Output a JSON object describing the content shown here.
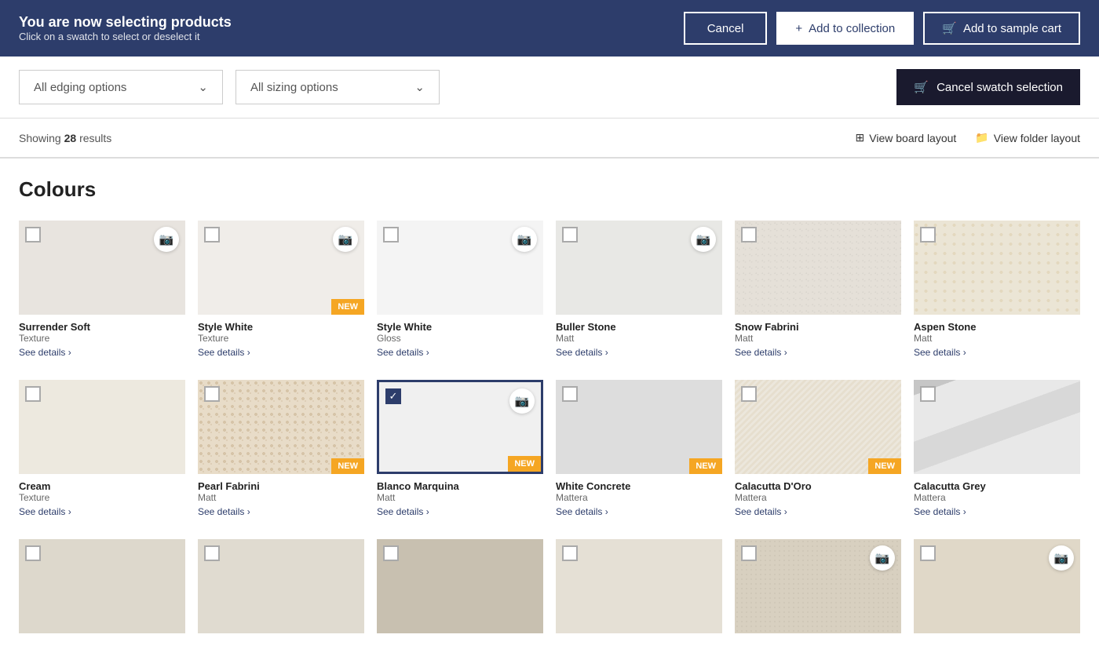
{
  "topBar": {
    "heading": "You are now selecting products",
    "subtext": "Click on a swatch to select or deselect it",
    "cancelLabel": "Cancel",
    "addToCollectionLabel": "Add to collection",
    "addToSampleCartLabel": "Add to sample cart"
  },
  "filters": {
    "edgingPlaceholder": "All edging options",
    "sizingPlaceholder": "All sizing options",
    "cancelSwatchLabel": "Cancel swatch selection"
  },
  "results": {
    "showing": "Showing",
    "count": "28",
    "resultsLabel": "results",
    "viewBoardLabel": "View board layout",
    "viewFolderLabel": "View folder layout"
  },
  "section": {
    "title": "Colours"
  },
  "row1": [
    {
      "name": "Surrender Soft",
      "type": "Texture",
      "link": "See details",
      "new": false,
      "checked": false,
      "camera": true,
      "swatchClass": "swatch-surrender"
    },
    {
      "name": "Style White",
      "type": "Texture",
      "link": "See details",
      "new": true,
      "checked": false,
      "camera": true,
      "swatchClass": "swatch-style-white-texture"
    },
    {
      "name": "Style White",
      "type": "Gloss",
      "link": "See details",
      "new": false,
      "checked": false,
      "camera": true,
      "swatchClass": "swatch-style-white-gloss"
    },
    {
      "name": "Buller Stone",
      "type": "Matt",
      "link": "See details",
      "new": false,
      "checked": false,
      "camera": true,
      "swatchClass": "swatch-buller"
    },
    {
      "name": "Snow Fabrini",
      "type": "Matt",
      "link": "See details",
      "new": false,
      "checked": false,
      "camera": false,
      "swatchClass": "swatch-snow"
    },
    {
      "name": "Aspen Stone",
      "type": "Matt",
      "link": "See details",
      "new": false,
      "checked": false,
      "camera": false,
      "swatchClass": "swatch-aspen"
    }
  ],
  "row2": [
    {
      "name": "Cream",
      "type": "Texture",
      "link": "See details",
      "new": false,
      "checked": false,
      "camera": false,
      "swatchClass": "swatch-cream"
    },
    {
      "name": "Pearl Fabrini",
      "type": "Matt",
      "link": "See details",
      "new": true,
      "checked": false,
      "camera": false,
      "swatchClass": "swatch-pearl"
    },
    {
      "name": "Blanco Marquina",
      "type": "Matt",
      "link": "See details",
      "new": true,
      "checked": true,
      "camera": true,
      "swatchClass": "swatch-blanco",
      "selected": true
    },
    {
      "name": "White Concrete",
      "type": "Mattera",
      "link": "See details",
      "new": true,
      "checked": false,
      "camera": false,
      "swatchClass": "swatch-white-concrete"
    },
    {
      "name": "Calacutta D'Oro",
      "type": "Mattera",
      "link": "See details",
      "new": true,
      "checked": false,
      "camera": false,
      "swatchClass": "swatch-calacutta-doro"
    },
    {
      "name": "Calacutta Grey",
      "type": "Mattera",
      "link": "See details",
      "new": false,
      "checked": false,
      "camera": false,
      "swatchClass": "swatch-calacutta-grey"
    }
  ],
  "row3": [
    {
      "name": "",
      "type": "",
      "link": "",
      "new": false,
      "checked": false,
      "camera": false,
      "swatchClass": "swatch-bottom1"
    },
    {
      "name": "",
      "type": "",
      "link": "",
      "new": false,
      "checked": false,
      "camera": false,
      "swatchClass": "swatch-bottom2"
    },
    {
      "name": "",
      "type": "",
      "link": "",
      "new": false,
      "checked": false,
      "camera": false,
      "swatchClass": "swatch-bottom3"
    },
    {
      "name": "",
      "type": "",
      "link": "",
      "new": false,
      "checked": false,
      "camera": false,
      "swatchClass": "swatch-bottom4"
    },
    {
      "name": "",
      "type": "",
      "link": "",
      "new": false,
      "checked": false,
      "camera": true,
      "swatchClass": "swatch-bottom5"
    },
    {
      "name": "",
      "type": "",
      "link": "",
      "new": false,
      "checked": false,
      "camera": true,
      "swatchClass": "swatch-bottom6"
    }
  ]
}
